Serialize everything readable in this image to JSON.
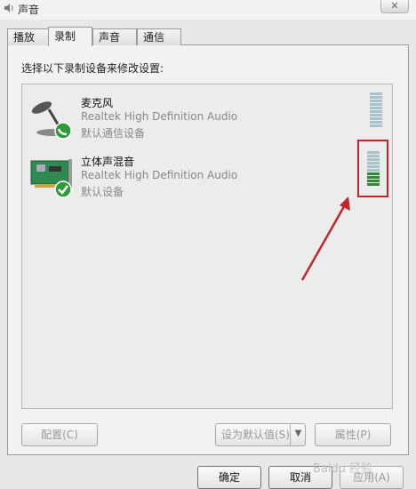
{
  "window": {
    "title": "声音",
    "close_label": "✕"
  },
  "tabs": [
    {
      "label": "播放",
      "active": false
    },
    {
      "label": "录制",
      "active": true
    },
    {
      "label": "声音",
      "active": false
    },
    {
      "label": "通信",
      "active": false
    }
  ],
  "instruction": "选择以下录制设备来修改设置:",
  "devices": [
    {
      "name": "麦克风",
      "driver": "Realtek High Definition Audio",
      "status": "默认通信设备",
      "icon": "microphone-icon",
      "badge_icon": "phone-badge-icon",
      "level": 0
    },
    {
      "name": "立体声混音",
      "driver": "Realtek High Definition Audio",
      "status": "默认设备",
      "icon": "sound-card-icon",
      "badge_icon": "check-badge-icon",
      "level": 0.4
    }
  ],
  "buttons": {
    "configure": "配置(C)",
    "set_default": "设为默认值(S)",
    "properties": "属性(P)",
    "ok": "确定",
    "cancel": "取消",
    "apply": "应用(A)"
  },
  "watermark": "Baidu 经验",
  "colors": {
    "meter_on": "#2f8a33",
    "meter_off": "#a9c4c8",
    "highlight": "#c0272d"
  }
}
